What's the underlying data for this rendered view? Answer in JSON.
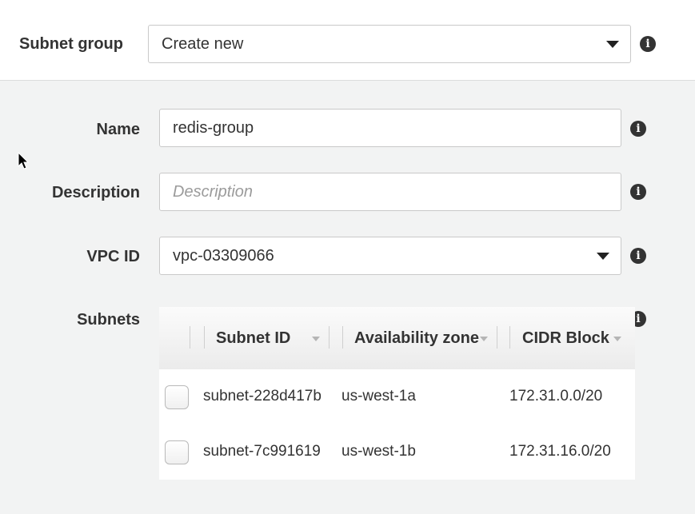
{
  "subnet_group": {
    "label": "Subnet group",
    "value": "Create new"
  },
  "form": {
    "name": {
      "label": "Name",
      "value": "redis-group"
    },
    "description": {
      "label": "Description",
      "placeholder": "Description"
    },
    "vpc": {
      "label": "VPC ID",
      "value": "vpc-03309066"
    },
    "subnets": {
      "label": "Subnets"
    }
  },
  "table": {
    "headers": {
      "subnet_id": "Subnet ID",
      "availability_zone": "Availability zone",
      "cidr_block": "CIDR Block"
    },
    "rows": [
      {
        "subnet_id": "subnet-228d417b",
        "zone": "us-west-1a",
        "cidr": "172.31.0.0/20"
      },
      {
        "subnet_id": "subnet-7c991619",
        "zone": "us-west-1b",
        "cidr": "172.31.16.0/20"
      }
    ]
  },
  "icons": {
    "info": "i"
  },
  "colors": {
    "panel_bg": "#f2f3f3",
    "info_icon": "#333333",
    "placeholder": "#9b9b9b"
  }
}
